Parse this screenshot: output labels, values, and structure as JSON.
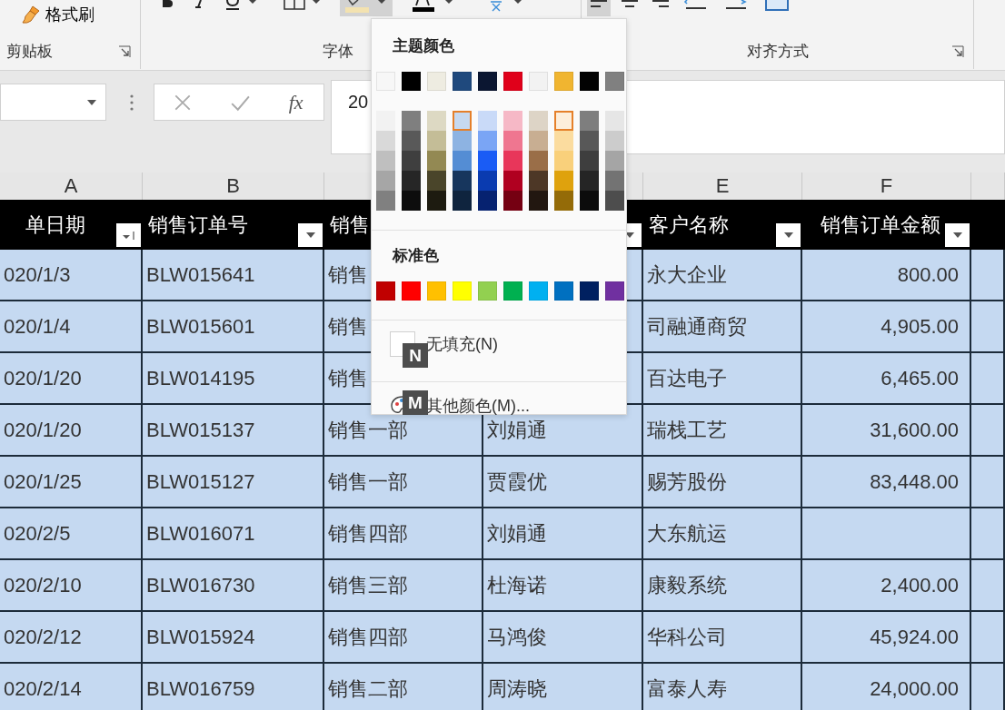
{
  "ribbon": {
    "groups": [
      {
        "label": "剪贴板",
        "launcher": true,
        "tools": [
          {
            "kind": "format-painter",
            "label": "格式刷",
            "selected": false
          }
        ]
      },
      {
        "label": "字体",
        "launcher": false,
        "tools": [
          {
            "kind": "bold",
            "selected": false
          },
          {
            "kind": "italic",
            "selected": false
          },
          {
            "kind": "underline",
            "selected": false
          },
          {
            "kind": "border",
            "selected": false
          },
          {
            "kind": "fill-color",
            "selected": true
          },
          {
            "kind": "font-color",
            "selected": false
          },
          {
            "kind": "phonetic",
            "selected": false
          }
        ]
      },
      {
        "label": "对齐方式",
        "launcher": true,
        "tools": [
          {
            "kind": "align-left",
            "selected": true
          },
          {
            "kind": "align-center",
            "selected": false
          },
          {
            "kind": "align-right",
            "selected": false
          },
          {
            "kind": "indent-decrease",
            "selected": false
          },
          {
            "kind": "indent-increase",
            "selected": false
          },
          {
            "kind": "merge",
            "selected": false
          }
        ]
      }
    ]
  },
  "formula_bar": {
    "function_label": "fx",
    "value": "20"
  },
  "sheet": {
    "columns": [
      {
        "letter": "A",
        "heading": "单日期",
        "filter": true,
        "sorted": true
      },
      {
        "letter": "B",
        "heading": "销售订单号",
        "filter": true,
        "sorted": false
      },
      {
        "heading": "销售"
      },
      {
        "filter": true,
        "sorted": false
      },
      {
        "letter": "E",
        "heading": "客户名称",
        "filter": true,
        "sorted": false
      },
      {
        "letter": "F",
        "heading": "销售订单金额",
        "filter": true,
        "sorted": false
      }
    ],
    "rows": [
      {
        "date": "020/1/3",
        "order_no": "BLW015641",
        "dept": "销售",
        "customer": "永大企业",
        "amount": "800.00"
      },
      {
        "date": "020/1/4",
        "order_no": "BLW015601",
        "dept": "销售",
        "customer": "司融通商贸",
        "amount": "4,905.00"
      },
      {
        "date": "020/1/20",
        "order_no": "BLW014195",
        "dept": "销售",
        "customer": "百达电子",
        "amount": "6,465.00"
      },
      {
        "date": "020/1/20",
        "order_no": "BLW015137",
        "dept": "销售一部",
        "rep": "刘娟通",
        "customer": "瑞栈工艺",
        "amount": "31,600.00"
      },
      {
        "date": "020/1/25",
        "order_no": "BLW015127",
        "dept": "销售一部",
        "rep": "贾霞优",
        "customer": "赐芳股份",
        "amount": "83,448.00"
      },
      {
        "date": "020/2/5",
        "order_no": "BLW016071",
        "dept": "销售四部",
        "rep": "刘娟通",
        "customer": "大东航运"
      },
      {
        "date": "020/2/10",
        "order_no": "BLW016730",
        "dept": "销售三部",
        "rep": "杜海诺",
        "customer": "康毅系统",
        "amount": "2,400.00"
      },
      {
        "date": "020/2/12",
        "order_no": "BLW015924",
        "dept": "销售四部",
        "rep": "马鸿俊",
        "customer": "华科公司",
        "amount": "45,924.00"
      },
      {
        "date": "020/2/14",
        "order_no": "BLW016759",
        "dept": "销售二部",
        "rep": "周涛晓",
        "customer": "富泰人寿",
        "amount": "24,000.00"
      }
    ]
  },
  "fill_menu": {
    "theme_title": "主题颜色",
    "theme_colors": [
      {
        "color": "#f7f7f7",
        "selected": false
      },
      {
        "color": "#000000",
        "selected": false
      },
      {
        "color": "#eeece1",
        "selected": false
      },
      {
        "color": "#1f497d",
        "selected": false
      },
      {
        "color": "#0b1631",
        "selected": false
      },
      {
        "color": "#e0001a",
        "selected": false
      },
      {
        "color": "#f2f2f2",
        "selected": false
      },
      {
        "color": "#f0b530",
        "selected": false
      },
      {
        "color": "#020202",
        "selected": false
      },
      {
        "color": "#808080",
        "selected": false
      }
    ],
    "shade_columns": [
      {
        "shades": [
          {
            "color": "#f2f2f2",
            "selected": false
          },
          {
            "color": "#d9d9d9",
            "selected": false
          },
          {
            "color": "#bfbfbf",
            "selected": false
          },
          {
            "color": "#a6a6a6",
            "selected": false
          },
          {
            "color": "#808080",
            "selected": false
          }
        ]
      },
      {
        "shades": [
          {
            "color": "#7f7f7f",
            "selected": false
          },
          {
            "color": "#595959",
            "selected": false
          },
          {
            "color": "#3f3f3f",
            "selected": false
          },
          {
            "color": "#262626",
            "selected": false
          },
          {
            "color": "#0d0d0d",
            "selected": false
          }
        ]
      },
      {
        "shades": [
          {
            "color": "#ddd9c3",
            "selected": false
          },
          {
            "color": "#c4bd97",
            "selected": false
          },
          {
            "color": "#938953",
            "selected": false
          },
          {
            "color": "#4a452a",
            "selected": false
          },
          {
            "color": "#1d1b10",
            "selected": false
          }
        ]
      },
      {
        "shades": [
          {
            "color": "#c6d9f0",
            "selected": true
          },
          {
            "color": "#8db3e2",
            "selected": false
          },
          {
            "color": "#548dd4",
            "selected": false
          },
          {
            "color": "#17365d",
            "selected": false
          },
          {
            "color": "#0f243e",
            "selected": false
          }
        ]
      },
      {
        "shades": [
          {
            "color": "#c9daf8",
            "selected": false
          },
          {
            "color": "#7aa5f5",
            "selected": false
          },
          {
            "color": "#1a5cf5",
            "selected": false
          },
          {
            "color": "#0a3bb0",
            "selected": false
          },
          {
            "color": "#062270",
            "selected": false
          }
        ]
      },
      {
        "shades": [
          {
            "color": "#f6b8c6",
            "selected": false
          },
          {
            "color": "#ef7690",
            "selected": false
          },
          {
            "color": "#e8365a",
            "selected": false
          },
          {
            "color": "#b00020",
            "selected": false
          },
          {
            "color": "#750012",
            "selected": false
          }
        ]
      },
      {
        "shades": [
          {
            "color": "#ddd4c6",
            "selected": false
          },
          {
            "color": "#c8ae92",
            "selected": false
          },
          {
            "color": "#9a6e48",
            "selected": false
          },
          {
            "color": "#4d3726",
            "selected": false
          },
          {
            "color": "#221710",
            "selected": false
          }
        ]
      },
      {
        "shades": [
          {
            "color": "#fdeedb",
            "selected": true
          },
          {
            "color": "#fbdc9f",
            "selected": false
          },
          {
            "color": "#f9d07b",
            "selected": false
          },
          {
            "color": "#dfa20d",
            "selected": false
          },
          {
            "color": "#946b08",
            "selected": false
          }
        ]
      },
      {
        "shades": [
          {
            "color": "#7e7e7e",
            "selected": false
          },
          {
            "color": "#585858",
            "selected": false
          },
          {
            "color": "#3e3e3e",
            "selected": false
          },
          {
            "color": "#252525",
            "selected": false
          },
          {
            "color": "#0c0c0c",
            "selected": false
          }
        ]
      },
      {
        "shades": [
          {
            "color": "#e6e6e6",
            "selected": false
          },
          {
            "color": "#cccccc",
            "selected": false
          },
          {
            "color": "#a5a5a5",
            "selected": false
          },
          {
            "color": "#737373",
            "selected": false
          },
          {
            "color": "#4d4d4d",
            "selected": false
          }
        ]
      }
    ],
    "standard_title": "标准色",
    "standard_colors": [
      {
        "color": "#c00000",
        "selected": false
      },
      {
        "color": "#ff0000",
        "selected": false
      },
      {
        "color": "#ffc000",
        "selected": false
      },
      {
        "color": "#ffff00",
        "selected": false
      },
      {
        "color": "#92d050",
        "selected": false
      },
      {
        "color": "#00b050",
        "selected": false
      },
      {
        "color": "#00b0f0",
        "selected": false
      },
      {
        "color": "#0070c0",
        "selected": false
      },
      {
        "color": "#002060",
        "selected": false
      },
      {
        "color": "#7030a0",
        "selected": false
      }
    ],
    "items": [
      {
        "kind": "no-fill",
        "label": "无填充(N)",
        "key_tip": "N"
      },
      {
        "kind": "more-colors",
        "label": "其他颜色(M)...",
        "key_tip": "M"
      }
    ]
  }
}
